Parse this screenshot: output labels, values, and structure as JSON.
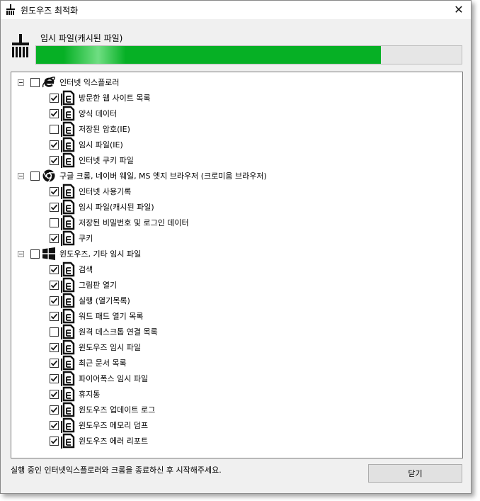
{
  "window": {
    "title": "윈도우즈 최적화",
    "close_symbol": "✕"
  },
  "progress": {
    "label": "임시 파일(캐시된 파일)",
    "value": 0.81,
    "color": "#06b025"
  },
  "groups": [
    {
      "label": "인터넷 익스플로러",
      "icon": "internet-explorer-icon",
      "checked": false,
      "items": [
        {
          "label": "방문한 웹 사이트 목록",
          "checked": true
        },
        {
          "label": "양식 데이터",
          "checked": true
        },
        {
          "label": "저장된 암호(IE)",
          "checked": false
        },
        {
          "label": "임시 파일(IE)",
          "checked": true
        },
        {
          "label": "인터넷 쿠키 파일",
          "checked": true
        }
      ]
    },
    {
      "label": "구글 크롬, 네이버 웨일, MS 엣지 브라우저 (크로미움 브라우저)",
      "icon": "chrome-icon",
      "checked": false,
      "items": [
        {
          "label": "인터넷 사용기록",
          "checked": true
        },
        {
          "label": "임시 파일(캐시된 파일)",
          "checked": true
        },
        {
          "label": "저장된 비밀번호 및 로그인 데이터",
          "checked": false
        },
        {
          "label": "쿠키",
          "checked": true
        }
      ]
    },
    {
      "label": "윈도우즈, 기타 임시 파일",
      "icon": "windows-icon",
      "checked": false,
      "items": [
        {
          "label": "검색",
          "checked": true
        },
        {
          "label": "그림판 열기",
          "checked": true
        },
        {
          "label": "실행 (열기목록)",
          "checked": true
        },
        {
          "label": "워드 패드 열기 목록",
          "checked": true
        },
        {
          "label": "원격 데스크톱 연결 목록",
          "checked": false
        },
        {
          "label": "윈도우즈 임시 파일",
          "checked": true
        },
        {
          "label": "최근 문서 목록",
          "checked": true
        },
        {
          "label": "파이어폭스 임시 파일",
          "checked": true
        },
        {
          "label": "휴지통",
          "checked": true
        },
        {
          "label": "윈도우즈 업데이트 로그",
          "checked": true
        },
        {
          "label": "윈도우즈 메모리 덤프",
          "checked": true
        },
        {
          "label": "윈도우즈 에러 리포트",
          "checked": true
        }
      ]
    }
  ],
  "status_text": "실행 중인 인터넷익스플로러와 크롬을 종료하신 후 시작해주세요.",
  "close_button_label": "닫기"
}
